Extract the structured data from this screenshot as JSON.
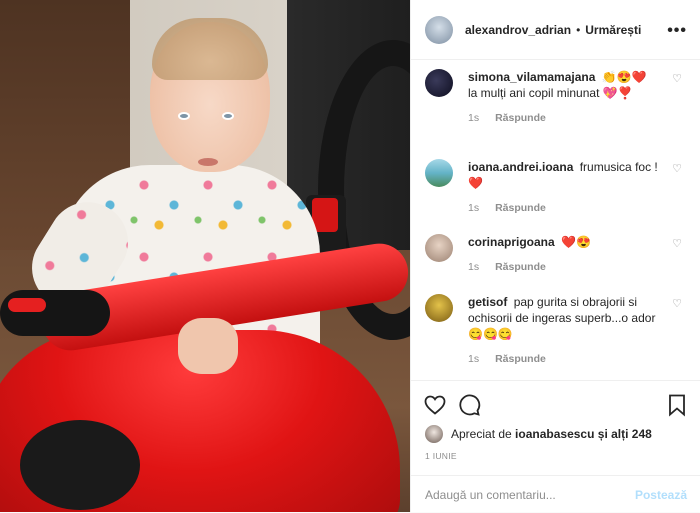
{
  "header": {
    "username": "alexandrov_adrian",
    "separator": "•",
    "follow_label": "Urmărești",
    "more_label": "•••"
  },
  "comments": [
    {
      "user": "simona_vilamamajana",
      "text": "👏😍❤️ la mulți ani copil minunat 💖❣️",
      "time": "1s",
      "reply": "Răspunde"
    },
    {
      "user": "ioana.andrei.ioana",
      "text": "frumusica foc ! ❤️",
      "time": "1s",
      "reply": "Răspunde"
    },
    {
      "user": "corinaprigoana",
      "text": "❤️😍",
      "time": "1s",
      "reply": "Răspunde"
    },
    {
      "user": "getisof",
      "text": "pap gurita si obrajorii si ochisorii de ingeras superb...o ador 😋😋😋",
      "time": "1s",
      "reply": "Răspunde"
    }
  ],
  "likes": {
    "prefix": "Apreciat de",
    "user": "ioanabasescu",
    "suffix": "și alți 248"
  },
  "date": "1 IUNIE",
  "add_comment": {
    "placeholder": "Adaugă un comentariu...",
    "post_label": "Postează"
  },
  "icons": {
    "like": "heart-icon",
    "comment": "comment-icon",
    "save": "bookmark-icon",
    "comment_like": "small-heart-icon"
  },
  "colors": {
    "post_button": "#b2dffc",
    "secondary_text": "#8e8e8e"
  }
}
